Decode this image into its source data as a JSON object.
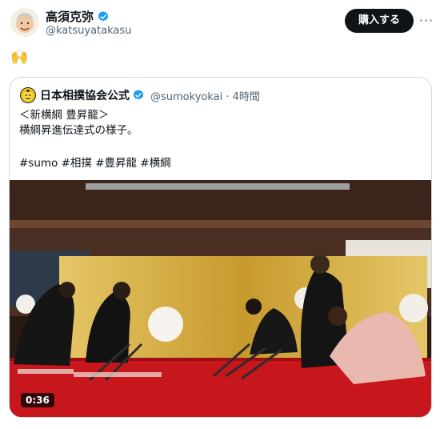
{
  "author": {
    "name": "高須克弥",
    "handle": "@katsuyatakasu",
    "verified": true
  },
  "actions": {
    "buy_label": "購入する",
    "more_label": "···"
  },
  "tweet": {
    "text": "🙌"
  },
  "quote": {
    "name": "日本相撲協会公式",
    "meta": "@sumokyokai · 4時間",
    "lines": [
      "＜新横綱 豊昇龍＞",
      "横綱昇進伝達式の様子。"
    ],
    "hashtags": "#sumo #相撲 #豊昇龍 #横綱",
    "video_duration": "0:36"
  },
  "colors": {
    "verified_blue": "#1d9bf0",
    "carpet_red": "#c8161d",
    "gold_screen": "#d4a937"
  }
}
